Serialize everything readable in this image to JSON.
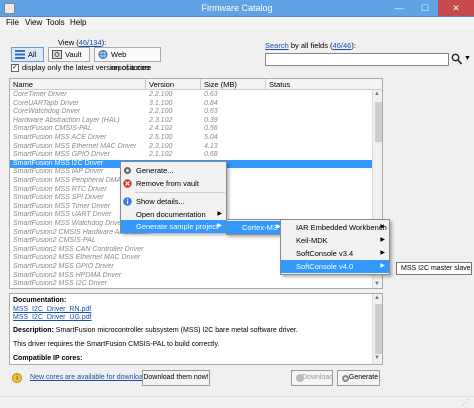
{
  "window": {
    "title": "Firmware Catalog",
    "controls": {
      "minimize": "—",
      "maximize": "☐",
      "close": "✕"
    }
  },
  "menubar": [
    "File",
    "View",
    "Tools",
    "Help"
  ],
  "view": {
    "label_prefix": "View (",
    "count": "46/134",
    "label_suffix": "):"
  },
  "toolbar": {
    "all": "All",
    "vault": "Vault",
    "web": "Web repositories"
  },
  "filter": {
    "latest_only": "display only the latest version of a core",
    "checked": "✓"
  },
  "search": {
    "link": "Search",
    "mid": " by all fields (",
    "count": "46/46",
    "end": "):",
    "value": ""
  },
  "columns": {
    "name": "Name",
    "version": "Version",
    "size": "Size (MB)",
    "status": "Status"
  },
  "rows": [
    {
      "name": "CoreTimer Driver",
      "version": "2.2.100",
      "size": "0.63"
    },
    {
      "name": "CoreUARTapb Driver",
      "version": "3.1.100",
      "size": "0.84"
    },
    {
      "name": "CoreWatchdog Driver",
      "version": "2.2.100",
      "size": "0.63"
    },
    {
      "name": "Hardware Abstraction Layer (HAL)",
      "version": "2.3.102",
      "size": "0.39"
    },
    {
      "name": "SmartFusion CMSIS-PAL",
      "version": "2.4.102",
      "size": "0.56"
    },
    {
      "name": "SmartFusion MSS ACE Driver",
      "version": "2.5.100",
      "size": "5.04"
    },
    {
      "name": "SmartFusion MSS Ethernet MAC Driver",
      "version": "2.3.100",
      "size": "4.13"
    },
    {
      "name": "SmartFusion MSS GPIO Driver",
      "version": "2.1.102",
      "size": "0.68"
    },
    {
      "name": "SmartFusion MSS I2C Driver",
      "version": "",
      "size": ""
    },
    {
      "name": "SmartFusion MSS IAP Driver",
      "version": "",
      "size": ""
    },
    {
      "name": "SmartFusion MSS Peripheral DMA",
      "version": "",
      "size": ""
    },
    {
      "name": "SmartFusion MSS RTC Driver",
      "version": "",
      "size": ""
    },
    {
      "name": "SmartFusion MSS SPI Driver",
      "version": "",
      "size": ""
    },
    {
      "name": "SmartFusion MSS Timer Driver",
      "version": "",
      "size": ""
    },
    {
      "name": "SmartFusion MSS UART Driver",
      "version": "",
      "size": ""
    },
    {
      "name": "SmartFusion MSS Watchdog Driver",
      "version": "",
      "size": ""
    },
    {
      "name": "SmartFusion2 CMSIS Hardware Abstractio...",
      "version": "",
      "size": ""
    },
    {
      "name": "SmartFusion2 CMSIS-PAL",
      "version": "",
      "size": ""
    },
    {
      "name": "SmartFusion2 MSS CAN Controller Driver",
      "version": "",
      "size": ""
    },
    {
      "name": "SmartFusion2 MSS Ethernet MAC Driver",
      "version": "",
      "size": ""
    },
    {
      "name": "SmartFusion2 MSS GPIO Driver",
      "version": "",
      "size": ""
    },
    {
      "name": "SmartFusion2 MSS HPDMA Driver",
      "version": "",
      "size": ""
    },
    {
      "name": "SmartFusion2 MSS I2C Driver",
      "version": "",
      "size": ""
    }
  ],
  "selected_index": 8,
  "context_menu": [
    {
      "label": "Generate...",
      "icon": "gear-icon"
    },
    {
      "label": "Remove from vault",
      "icon": "red-x-icon"
    },
    {
      "label": "Show details...",
      "icon": "info-icon"
    },
    {
      "label": "Open documentation",
      "icon": ""
    },
    {
      "label": "Generate sample project",
      "icon": ""
    }
  ],
  "submenu_1": [
    "Cortex-M3"
  ],
  "submenu_2": [
    "IAR Embedded Workbench",
    "Keil-MDK",
    "SoftConsole v3.4",
    "SoftConsole v4.0"
  ],
  "tooltip": "MSS I2C master slave",
  "details": {
    "heading_docs": "Documentation:",
    "doc1": "MSS_I2C_Driver_RN.pdf",
    "doc2": "MSS_I2C_Driver_UG.pdf",
    "desc_label": "Description:",
    "desc_text": " SmartFusion microcontroller subsystem (MSS) I2C bare metal software driver.",
    "requires": "This driver requires the SmartFusion CMSIS-PAL to build correctly.",
    "compat": "Compatible IP cores:"
  },
  "bottom": {
    "new_cores": "New cores are available for download",
    "download_now": "Download them now!",
    "download": "Download",
    "generate": "Generate"
  }
}
